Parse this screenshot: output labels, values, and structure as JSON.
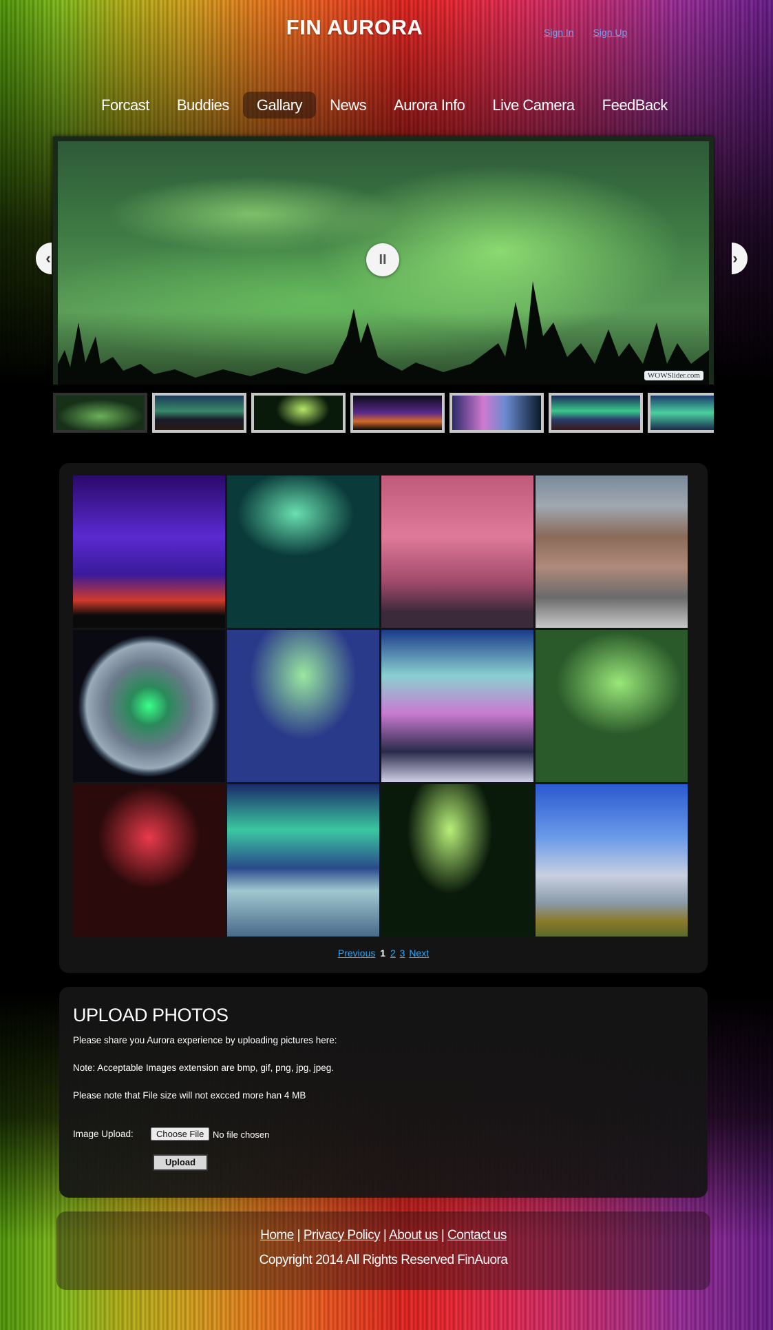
{
  "header": {
    "title": "FIN AURORA",
    "sign_in": "Sign In",
    "sign_up": "Sign Up"
  },
  "nav": {
    "items": [
      {
        "label": "Forcast",
        "active": false
      },
      {
        "label": "Buddies",
        "active": false
      },
      {
        "label": "Gallary",
        "active": true
      },
      {
        "label": "News",
        "active": false
      },
      {
        "label": "Aurora Info",
        "active": false
      },
      {
        "label": "Live Camera",
        "active": false
      },
      {
        "label": "FeedBack",
        "active": false
      }
    ]
  },
  "slider": {
    "watermark": "WOWSlider.com",
    "pause_glyph": "II",
    "prev_glyph": "‹",
    "next_glyph": "›",
    "thumbnail_count": 7
  },
  "gallery": {
    "pager": {
      "previous": "Previous",
      "pages": [
        "1",
        "2",
        "3"
      ],
      "current": "1",
      "next": "Next"
    }
  },
  "upload": {
    "heading": "UPLOAD PHOTOS",
    "line1": "Please share you Aurora experience by uploading pictures here:",
    "line2": "Note: Acceptable Images extension are bmp, gif, png, jpg, jpeg.",
    "line3": "Please note that File size will not excced more han 4 MB",
    "field_label": "Image Upload:",
    "choose_file": "Choose File",
    "file_status": "No file chosen",
    "upload_button": "Upload"
  },
  "footer": {
    "links": [
      "Home",
      "Privacy Policy",
      "About us",
      "Contact us"
    ],
    "separator": "|",
    "copyright": "Copyright 2014 All Rights Reserved FinAuora"
  }
}
